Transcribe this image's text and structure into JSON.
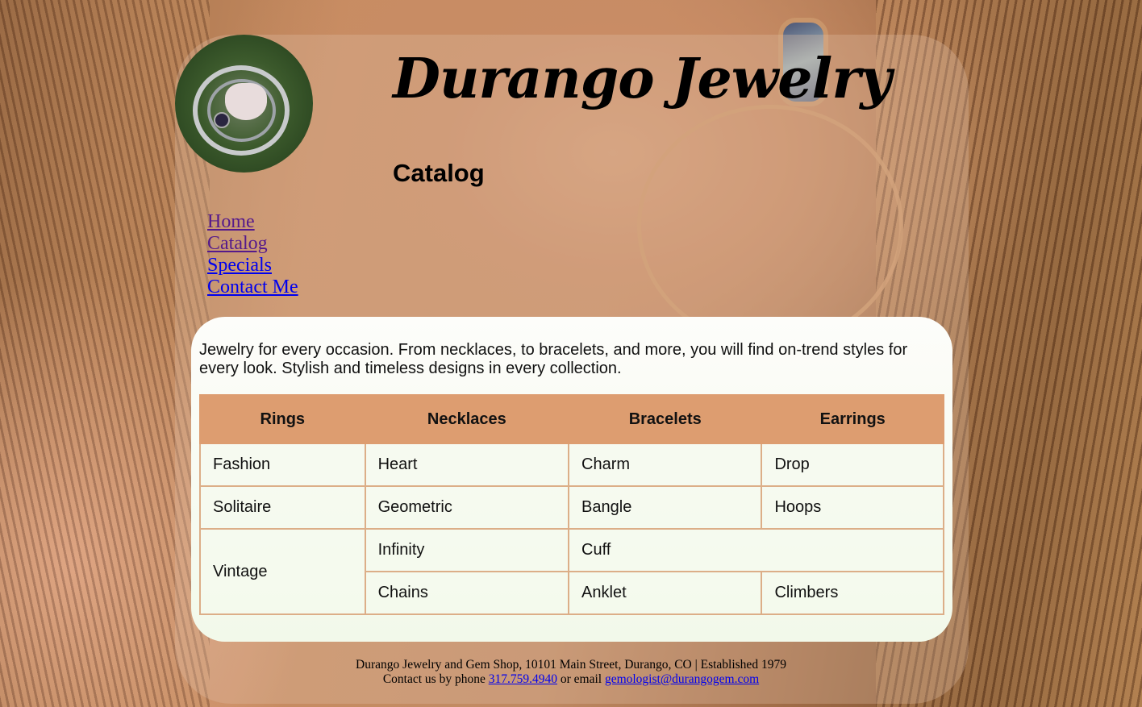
{
  "header": {
    "site_title": "Durango Jewelry",
    "page_title": "Catalog",
    "logo_icon": "pendant-logo-icon"
  },
  "nav": {
    "items": [
      {
        "label": "Home",
        "visited": true
      },
      {
        "label": "Catalog",
        "visited": true
      },
      {
        "label": "Specials",
        "visited": false
      },
      {
        "label": "Contact Me",
        "visited": false
      }
    ]
  },
  "main": {
    "intro": "Jewelry for every occasion. From necklaces, to bracelets, and more, you will find on-trend styles for every look. Stylish and timeless designs in every collection.",
    "table": {
      "headers": [
        "Rings",
        "Necklaces",
        "Bracelets",
        "Earrings"
      ],
      "rows": [
        [
          "Fashion",
          "Heart",
          "Charm",
          "Drop"
        ],
        [
          "Solitaire",
          "Geometric",
          "Bangle",
          "Hoops"
        ],
        [
          "Vintage",
          "Infinity",
          "Cuff"
        ],
        [
          "Chains",
          "Anklet",
          "Climbers"
        ]
      ]
    }
  },
  "footer": {
    "line1": "Durango Jewelry and Gem Shop, 10101 Main Street, Durango, CO | Established 1979",
    "phone_prefix": "Contact us by phone",
    "phone": "317.759.4940",
    "email_prefix": "or email",
    "email": "gemologist@durangogem.com"
  },
  "colors": {
    "table_header": "#dd9d70",
    "link": "#0000ee",
    "visited_link": "#551a8b"
  }
}
